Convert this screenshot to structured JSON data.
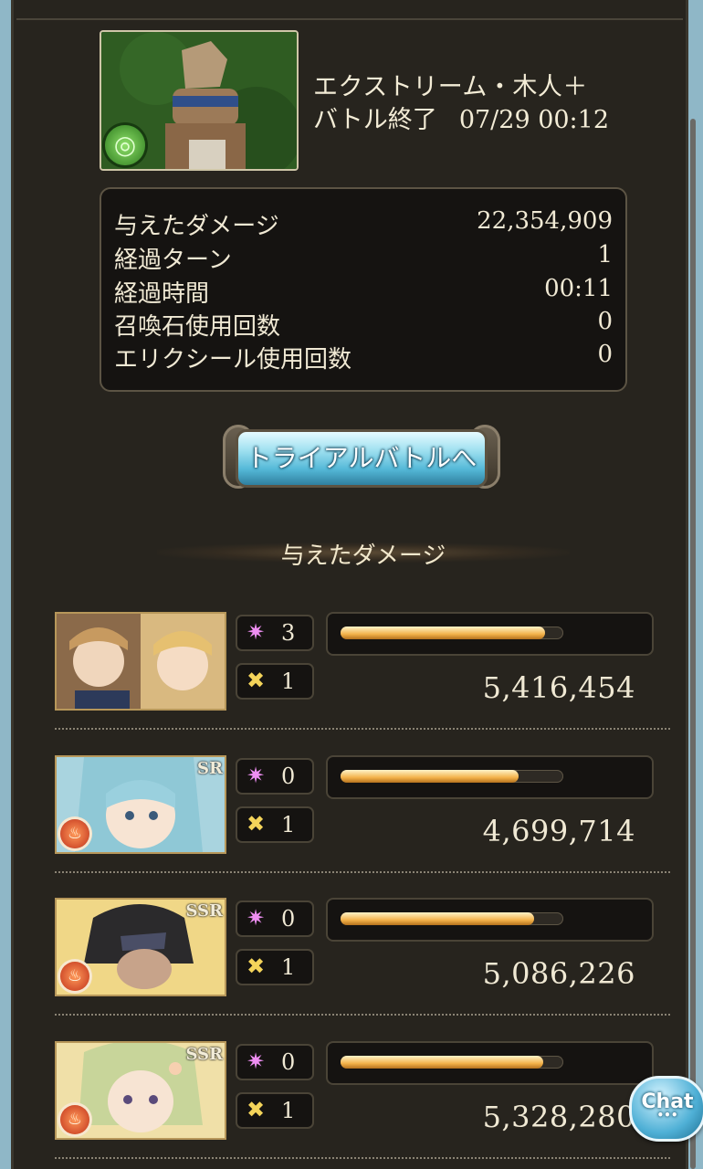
{
  "quest": {
    "title": "エクストリーム・木人＋",
    "status": "バトル終了",
    "time": "07/29 00:12",
    "element_icon": "wind-element-icon"
  },
  "stats": [
    {
      "label": "与えたダメージ",
      "value": "22,354,909"
    },
    {
      "label": "経過ターン",
      "value": "1"
    },
    {
      "label": "経過時間",
      "value": "00:11"
    },
    {
      "label": "召喚石使用回数",
      "value": "0"
    },
    {
      "label": "エリクシール使用回数",
      "value": "0"
    }
  ],
  "trial_button": {
    "label": "トライアルバトルへ"
  },
  "damage_section": {
    "title": "与えたダメージ"
  },
  "members": [
    {
      "rarity": "",
      "skill_count": "3",
      "ougi_count": "1",
      "damage": "5,416,454",
      "damage_ratio": 0.92,
      "colors": [
        "#c9a27a",
        "#2c3a5a"
      ]
    },
    {
      "rarity": "SR",
      "skill_count": "0",
      "ougi_count": "1",
      "damage": "4,699,714",
      "damage_ratio": 0.8,
      "colors": [
        "#a9d4df",
        "#dfeff3"
      ]
    },
    {
      "rarity": "SSR",
      "skill_count": "0",
      "ougi_count": "1",
      "damage": "5,086,226",
      "damage_ratio": 0.87,
      "colors": [
        "#e8c866",
        "#2b2a2c"
      ]
    },
    {
      "rarity": "SSR",
      "skill_count": "0",
      "ougi_count": "1",
      "damage": "5,328,280",
      "damage_ratio": 0.91,
      "colors": [
        "#f0e0a8",
        "#c8d59a"
      ]
    }
  ],
  "icons": {
    "skill": "skill-sparkle-icon",
    "ougi": "charge-attack-icon",
    "element": "fire-element-icon"
  },
  "chat": {
    "label": "Chat"
  }
}
